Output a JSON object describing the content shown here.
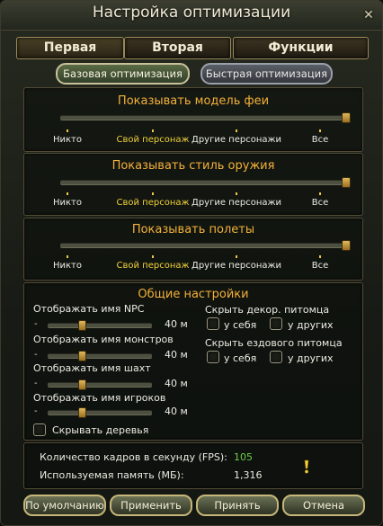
{
  "window": {
    "title": "Настройка оптимизации",
    "close_icon": "close-icon"
  },
  "tabs": [
    {
      "label": "Первая"
    },
    {
      "label": "Вторая"
    },
    {
      "label": "Функции"
    }
  ],
  "modes": [
    {
      "label": "Базовая оптимизация",
      "selected": true
    },
    {
      "label": "Быстрая оптимизация",
      "selected": false
    }
  ],
  "sliders": [
    {
      "title": "Показывать модель феи",
      "stops": [
        "Никто",
        "Свой персонаж",
        "Другие персонажи",
        "Все"
      ],
      "value": "Все"
    },
    {
      "title": "Показывать стиль оружия",
      "stops": [
        "Никто",
        "Свой персонаж",
        "Другие персонажи",
        "Все"
      ],
      "value": "Все"
    },
    {
      "title": "Показывать полеты",
      "stops": [
        "Никто",
        "Свой персонаж",
        "Другие персонажи",
        "Все"
      ],
      "value": "Все"
    }
  ],
  "general": {
    "title": "Общие настройки",
    "ranges": [
      {
        "label": "Отображать имя NPC",
        "minus": "-",
        "value": "40 м",
        "level": 0.33
      },
      {
        "label": "Отображать имя монстров",
        "minus": "-",
        "value": "40 м",
        "level": 0.33
      },
      {
        "label": "Отображать имя шахт",
        "minus": "-",
        "value": "40 м",
        "level": 0.33
      },
      {
        "label": "Отображать имя игроков",
        "minus": "-",
        "value": "40 м",
        "level": 0.33
      }
    ],
    "hide_trees": {
      "label": "Скрывать деревья",
      "checked": false
    },
    "pet_decor": {
      "label": "Скрыть декор. питомца",
      "self": "у себя",
      "others": "у других",
      "self_checked": false,
      "others_checked": false
    },
    "pet_mount": {
      "label": "Скрыть ездового питомца",
      "self": "у себя",
      "others": "у других",
      "self_checked": false,
      "others_checked": false
    }
  },
  "stats": {
    "fps_label": "Количество кадров в секунду (FPS):",
    "fps_value": "105",
    "mem_label": "Используемая память (МБ):",
    "mem_value": "1,316",
    "hint_icon": "exclamation-icon"
  },
  "buttons": {
    "default": "По умолчанию",
    "apply": "Применить",
    "accept": "Принять",
    "cancel": "Отмена"
  },
  "colors": {
    "accent": "#f3b13a",
    "selected_stop": "#f0d13a",
    "fps": "#6fd04a"
  }
}
